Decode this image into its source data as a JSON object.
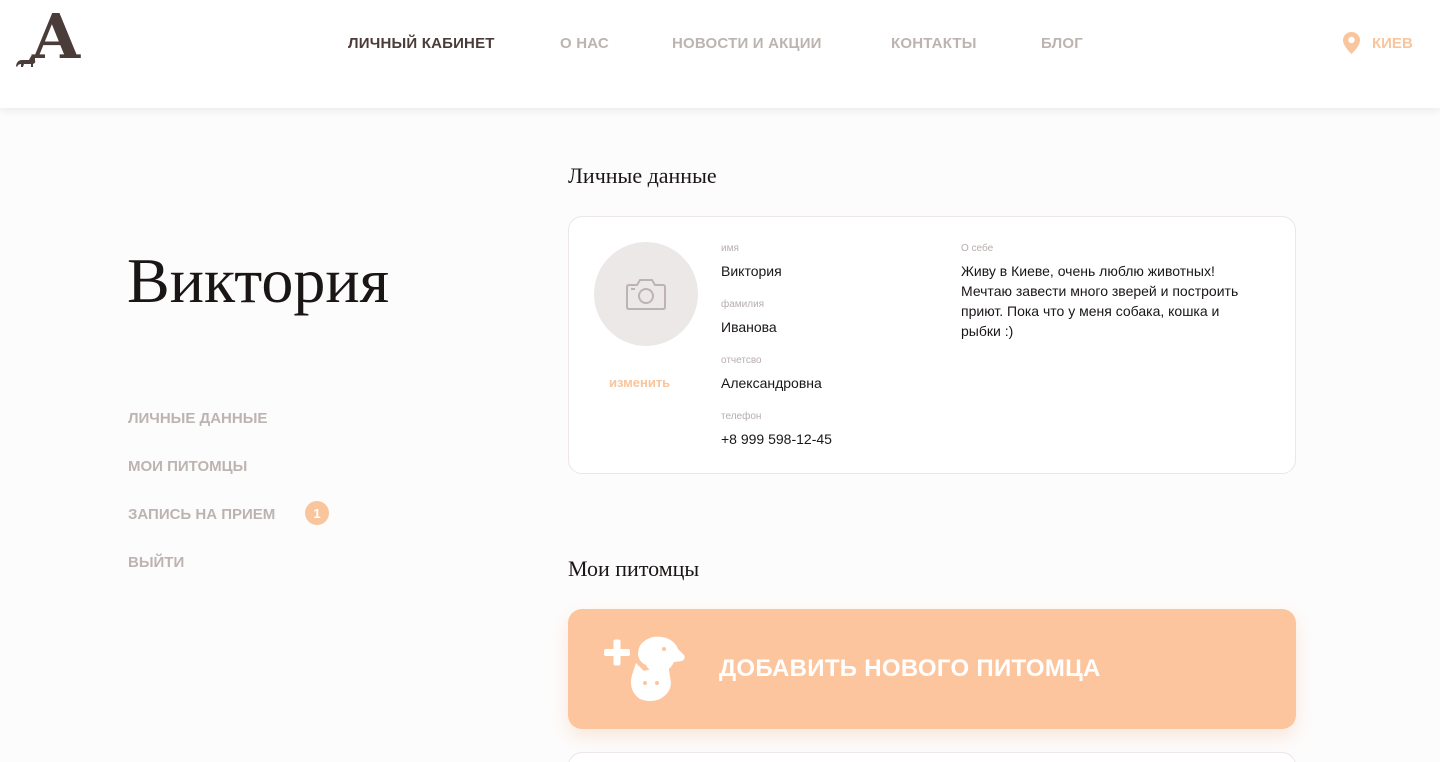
{
  "brand": {
    "logo_letter": "A"
  },
  "nav": {
    "items": [
      {
        "label": "ЛИЧНЫЙ КАБИНЕТ",
        "active": true
      },
      {
        "label": "О НАС",
        "active": false
      },
      {
        "label": "НОВОСТИ И АКЦИИ",
        "active": false
      },
      {
        "label": "КОНТАКТЫ",
        "active": false
      },
      {
        "label": "БЛОГ",
        "active": false
      }
    ],
    "city": "КИЕВ"
  },
  "user": {
    "display_name": "Виктория"
  },
  "sidebar": {
    "items": [
      {
        "label": "ЛИЧНЫЕ ДАННЫЕ"
      },
      {
        "label": "МОИ ПИТОМЦЫ"
      },
      {
        "label": "ЗАПИСЬ НА ПРИЕМ",
        "badge": "1"
      },
      {
        "label": "ВЫЙТИ"
      }
    ]
  },
  "personal": {
    "title": "Личные данные",
    "change_photo": "изменить",
    "fields": [
      {
        "label": "имя",
        "value": "Виктория"
      },
      {
        "label": "фамилия",
        "value": "Иванова"
      },
      {
        "label": "отчетсво",
        "value": "Александровна"
      },
      {
        "label": "телефон",
        "value": "+8 999 598-12-45"
      }
    ],
    "about_label": "О себе",
    "about_text": "Живу в Киеве, очень люблю животных! Мечтаю завести много зверей и построить приют. Пока что у меня собака, кошка и рыбки :)"
  },
  "pets": {
    "title": "Мои питомцы",
    "add_label": "ДОБАВИТЬ НОВОГО ПИТОМЦА"
  },
  "colors": {
    "accent": "#fcc59e",
    "nav_active": "#4a3c38",
    "nav_inactive": "#bdb4b1"
  }
}
